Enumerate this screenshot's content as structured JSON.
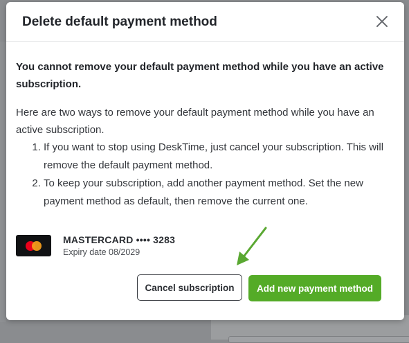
{
  "modal": {
    "title": "Delete default payment method",
    "close_icon": "close-icon",
    "warning": "You cannot remove your default payment method while you have an active subscription.",
    "intro": "Here are two ways to remove your default payment method while you have an active subscription.",
    "steps": [
      "If you want to stop using DeskTime, just cancel your subscription. This will remove the default payment method.",
      "To keep your subscription, add another payment method. Set the new payment method as default, then remove the current one."
    ],
    "card": {
      "brand_icon": "mastercard-icon",
      "name": "MASTERCARD •••• 3283",
      "expiry": "Expiry date 08/2029"
    },
    "buttons": {
      "cancel_subscription": "Cancel subscription",
      "add_payment_method": "Add new payment method"
    }
  },
  "colors": {
    "primary_green": "#54ab27",
    "annotation_arrow": "#5aa832",
    "overlay": "#8a8c8f"
  }
}
